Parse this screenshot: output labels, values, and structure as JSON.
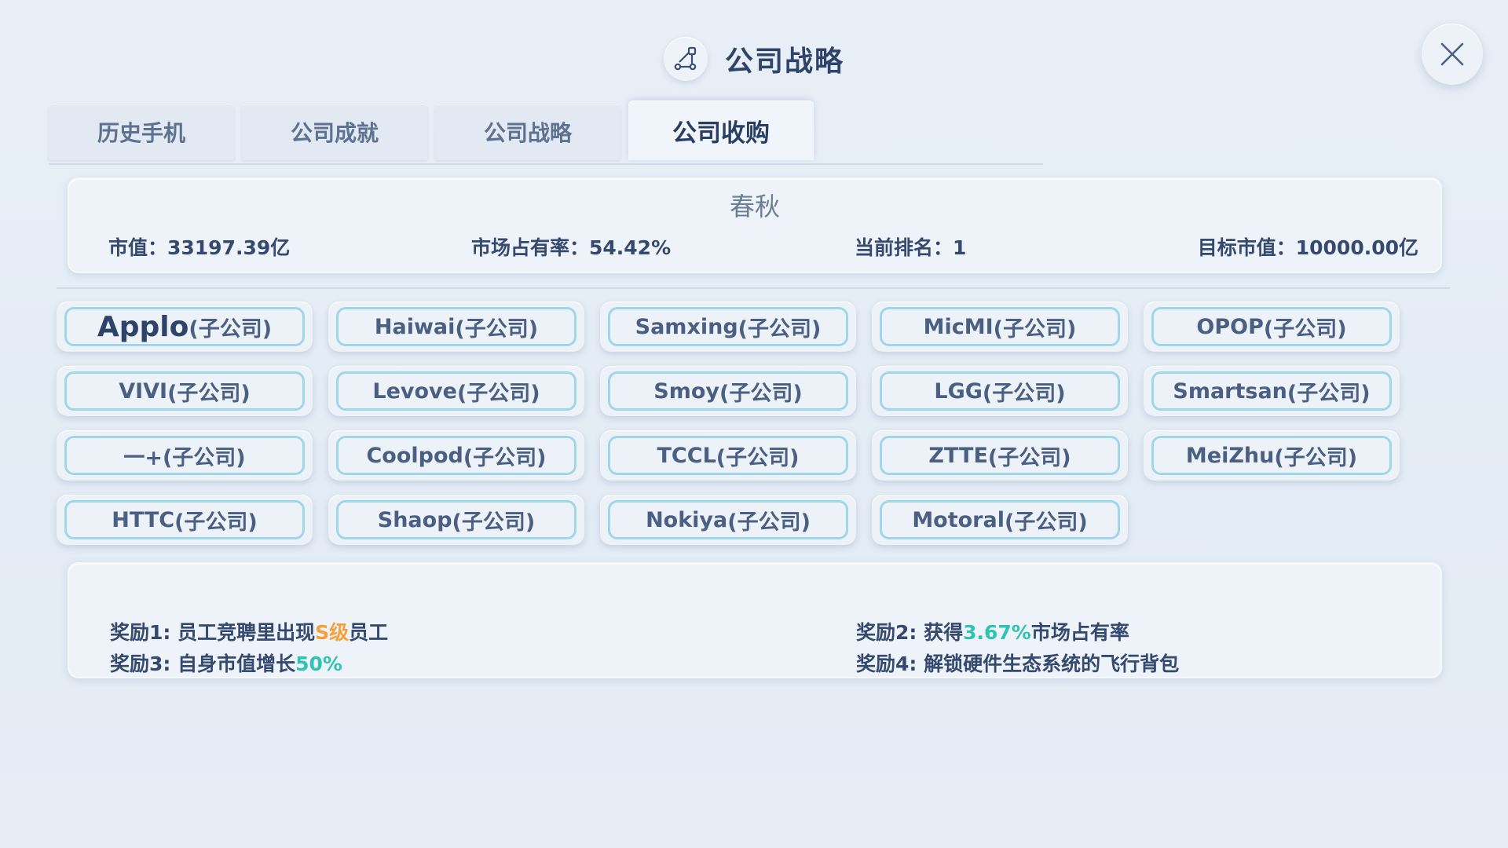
{
  "header": {
    "title": "公司战略",
    "icon": "strategy-flow-icon"
  },
  "close": {
    "icon": "close-icon"
  },
  "tabs": [
    {
      "label": "历史手机",
      "active": false
    },
    {
      "label": "公司成就",
      "active": false
    },
    {
      "label": "公司战略",
      "active": false
    },
    {
      "label": "公司收购",
      "active": true
    }
  ],
  "info": {
    "name": "春秋",
    "market_value": "市值：33197.39亿",
    "market_share": "市场占有率：54.42%",
    "rank": "当前排名：1",
    "target_value": "目标市值：10000.00亿"
  },
  "companies": [
    {
      "name": "Applo",
      "suffix": "(子公司)"
    },
    {
      "name": "Haiwai",
      "suffix": "(子公司)"
    },
    {
      "name": "Samxing",
      "suffix": "(子公司)"
    },
    {
      "name": "MicMI",
      "suffix": "(子公司)"
    },
    {
      "name": "OPOP",
      "suffix": "(子公司)"
    },
    {
      "name": "VIVI",
      "suffix": "(子公司)"
    },
    {
      "name": "Levove",
      "suffix": "(子公司)"
    },
    {
      "name": "Smoy",
      "suffix": "(子公司)"
    },
    {
      "name": "LGG",
      "suffix": "(子公司)"
    },
    {
      "name": "Smartsan",
      "suffix": "(子公司)"
    },
    {
      "name": "一+",
      "suffix": "(子公司)"
    },
    {
      "name": "Coolpod",
      "suffix": "(子公司)"
    },
    {
      "name": "TCCL",
      "suffix": "(子公司)"
    },
    {
      "name": "ZTTE",
      "suffix": "(子公司)"
    },
    {
      "name": "MeiZhu",
      "suffix": "(子公司)"
    },
    {
      "name": "HTTC",
      "suffix": "(子公司)"
    },
    {
      "name": "Shaop",
      "suffix": "(子公司)"
    },
    {
      "name": "Nokiya",
      "suffix": "(子公司)"
    },
    {
      "name": "Motoral",
      "suffix": "(子公司)"
    }
  ],
  "rewards": {
    "r1": {
      "prefix": "奖励1: 员工竞聘里出现",
      "highlight": "S级",
      "suffix": "员工"
    },
    "r2": {
      "prefix": "奖励2: 获得",
      "highlight": "3.67%",
      "suffix": "市场占有率"
    },
    "r3": {
      "prefix": "奖励3: 自身市值增长",
      "highlight": "50%",
      "suffix": ""
    },
    "r4": {
      "prefix": "奖励4: 解锁硬件生态系统的飞行背包",
      "highlight": "",
      "suffix": ""
    }
  },
  "colors": {
    "accent_orange": "#f3a13a",
    "accent_teal": "#2fc3b4",
    "button_border": "#9fd6ea",
    "text_dark": "#34496d"
  }
}
